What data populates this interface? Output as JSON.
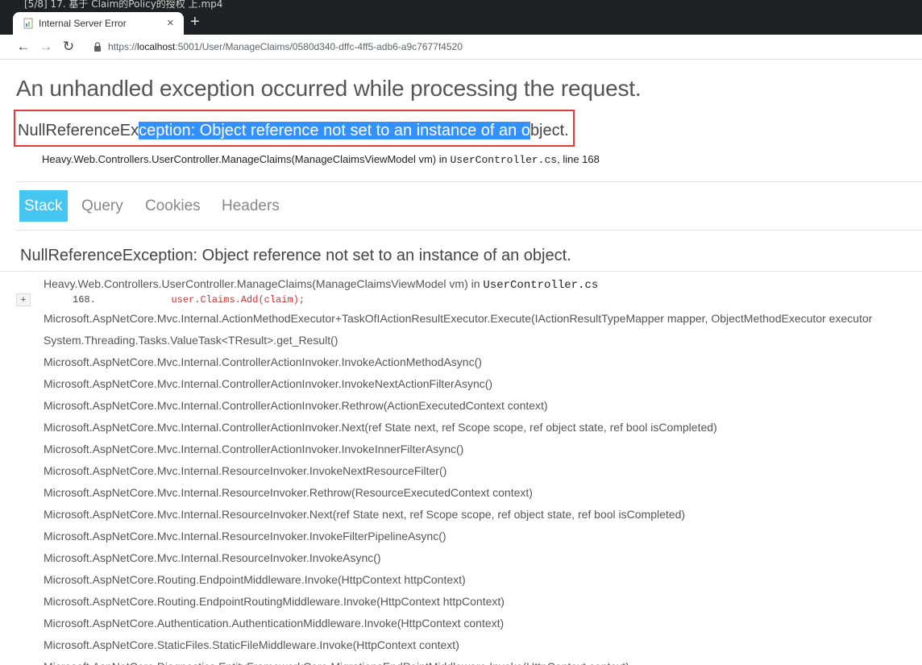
{
  "player": {
    "title": "[5/8] 17. 基于 Claim的Policy的授权 上.mp4"
  },
  "browser": {
    "tab_title": "Internal Server Error",
    "tab_close": "×",
    "newtab": "+",
    "nav": {
      "back": "←",
      "forward": "→",
      "reload": "↻"
    },
    "url_scheme": "https://",
    "url_host": "localhost",
    "url_rest": ":5001/User/ManageClaims/0580d340-dffc-4ff5-adb6-a9c7677f4520"
  },
  "page": {
    "heading": "An unhandled exception occurred while processing the request.",
    "error_prefix": "NullReferenceEx",
    "error_selected_1": "ception: Object reference not set to an instance of an o",
    "error_suffix": "bject.",
    "location_method": "Heavy.Web.Controllers.UserController.ManageClaims(ManageClaimsViewModel vm) in ",
    "location_file": "UserController.cs",
    "location_line": ", line 168",
    "tabs": [
      "Stack",
      "Query",
      "Cookies",
      "Headers"
    ],
    "exception_title": "NullReferenceException: Object reference not set to an instance of an object.",
    "frame_head_method": "Heavy.Web.Controllers.UserController.ManageClaims(ManageClaimsViewModel vm) in ",
    "frame_head_file": "UserController.cs",
    "expand_label": "+",
    "code_line_num": "168.",
    "code_line_text": "user.Claims.Add(claim);",
    "frames": [
      "Microsoft.AspNetCore.Mvc.Internal.ActionMethodExecutor+TaskOfIActionResultExecutor.Execute(IActionResultTypeMapper mapper, ObjectMethodExecutor executor",
      "System.Threading.Tasks.ValueTask<TResult>.get_Result()",
      "Microsoft.AspNetCore.Mvc.Internal.ControllerActionInvoker.InvokeActionMethodAsync()",
      "Microsoft.AspNetCore.Mvc.Internal.ControllerActionInvoker.InvokeNextActionFilterAsync()",
      "Microsoft.AspNetCore.Mvc.Internal.ControllerActionInvoker.Rethrow(ActionExecutedContext context)",
      "Microsoft.AspNetCore.Mvc.Internal.ControllerActionInvoker.Next(ref State next, ref Scope scope, ref object state, ref bool isCompleted)",
      "Microsoft.AspNetCore.Mvc.Internal.ControllerActionInvoker.InvokeInnerFilterAsync()",
      "Microsoft.AspNetCore.Mvc.Internal.ResourceInvoker.InvokeNextResourceFilter()",
      "Microsoft.AspNetCore.Mvc.Internal.ResourceInvoker.Rethrow(ResourceExecutedContext context)",
      "Microsoft.AspNetCore.Mvc.Internal.ResourceInvoker.Next(ref State next, ref Scope scope, ref object state, ref bool isCompleted)",
      "Microsoft.AspNetCore.Mvc.Internal.ResourceInvoker.InvokeFilterPipelineAsync()",
      "Microsoft.AspNetCore.Mvc.Internal.ResourceInvoker.InvokeAsync()",
      "Microsoft.AspNetCore.Routing.EndpointMiddleware.Invoke(HttpContext httpContext)",
      "Microsoft.AspNetCore.Routing.EndpointRoutingMiddleware.Invoke(HttpContext httpContext)",
      "Microsoft.AspNetCore.Authentication.AuthenticationMiddleware.Invoke(HttpContext context)",
      "Microsoft.AspNetCore.StaticFiles.StaticFileMiddleware.Invoke(HttpContext context)",
      "Microsoft.AspNetCore.Diagnostics.EntityFrameworkCore.MigrationsEndPointMiddleware.Invoke(HttpContext context)"
    ]
  }
}
